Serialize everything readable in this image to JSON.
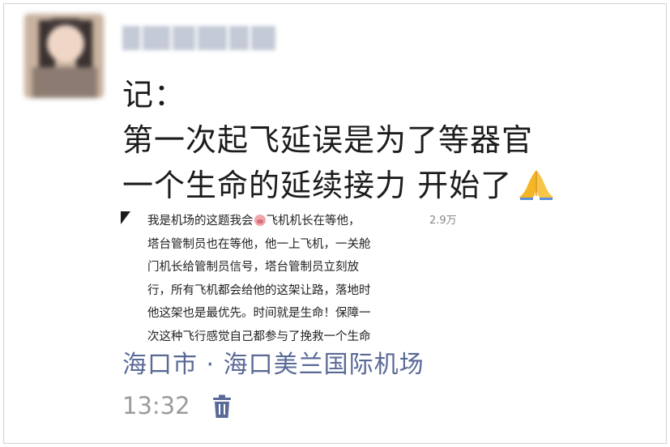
{
  "post": {
    "author": "",
    "text": "记：\n第一次起飞延误是为了等器官\n一个生命的延续接力 开始了",
    "emoji": "folded-hands-emoji",
    "comment": {
      "text_part1": "我是机场的这题我会",
      "emoji": "pig-face-emoji",
      "text_part2": "飞机机长在等他，\n塔台管制员也在等他，他一上飞机，一关舱\n门机长给管制员信号，塔台管制员立刻放\n行，所有飞机都会给他的这架让路，落地时\n他这架也是最优先。时间就是生命！保障一\n次这种飞行感觉自己都参与了挽救一个生命",
      "likes": "2.9万"
    },
    "location": "海口市 · 海口美兰国际机场",
    "time": "13:32"
  },
  "colors": {
    "location": "#5a6a97",
    "time": "#9b9b9b",
    "text": "#1c1c1c",
    "trash": "#5a6a97"
  },
  "icons": {
    "delete": "trash-icon"
  }
}
